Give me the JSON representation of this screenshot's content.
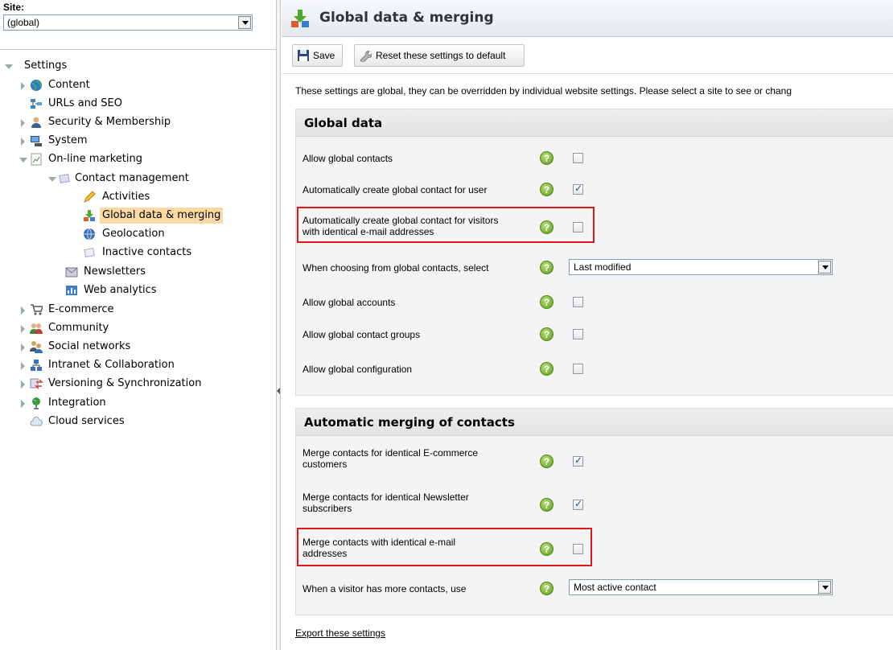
{
  "site": {
    "label": "Site:",
    "value": "(global)"
  },
  "tree": {
    "settings": "Settings",
    "content": "Content",
    "urls_seo": "URLs and SEO",
    "security": "Security & Membership",
    "system": "System",
    "online_marketing": "On-line marketing",
    "contact_management": "Contact management",
    "activities": "Activities",
    "global_data": "Global data & merging",
    "geolocation": "Geolocation",
    "inactive_contacts": "Inactive contacts",
    "newsletters": "Newsletters",
    "web_analytics": "Web analytics",
    "ecommerce": "E-commerce",
    "community": "Community",
    "social_networks": "Social networks",
    "intranet": "Intranet & Collaboration",
    "versioning": "Versioning & Synchronization",
    "integration": "Integration",
    "cloud_services": "Cloud services"
  },
  "header": {
    "title": "Global data & merging"
  },
  "toolbar": {
    "save": "Save",
    "reset": "Reset these settings to default"
  },
  "intro": "These settings are global, they can be overridden by individual website settings. Please select a site to see or chang",
  "global_data": {
    "title": "Global data",
    "allow_global_contacts": {
      "label": "Allow global contacts",
      "checked": false
    },
    "auto_create_user": {
      "label": "Automatically create global contact for user",
      "checked": true
    },
    "auto_create_visitors": {
      "label_1": "Automatically create global contact for visitors",
      "label_2": "with identical e-mail addresses",
      "checked": false
    },
    "choose_select": {
      "label": "When choosing from global contacts, select",
      "value": "Last modified"
    },
    "allow_global_accounts": {
      "label": "Allow global accounts",
      "checked": false
    },
    "allow_global_groups": {
      "label": "Allow global contact groups",
      "checked": false
    },
    "allow_global_config": {
      "label": "Allow global configuration",
      "checked": false
    }
  },
  "merging": {
    "title": "Automatic merging of contacts",
    "ecommerce": {
      "label_1": "Merge contacts for identical E-commerce",
      "label_2": "customers",
      "checked": true
    },
    "newsletter": {
      "label_1": "Merge contacts for identical Newsletter",
      "label_2": "subscribers",
      "checked": true
    },
    "email": {
      "label_1": "Merge contacts with identical e-mail",
      "label_2": "addresses",
      "checked": false
    },
    "more_contacts": {
      "label": "When a visitor has more contacts, use",
      "value": "Most active contact"
    }
  },
  "help_glyph": "?",
  "export": "Export these settings"
}
